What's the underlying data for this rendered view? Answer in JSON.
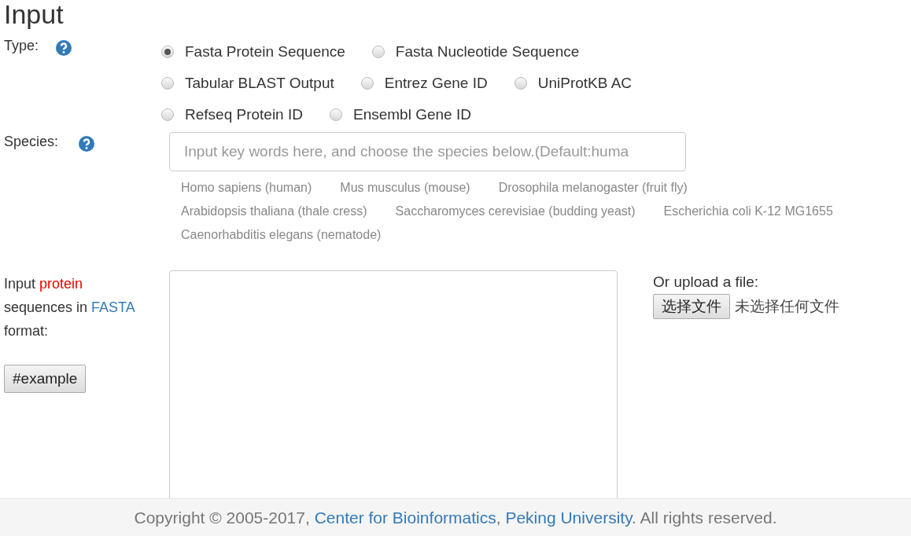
{
  "title": "Input",
  "type": {
    "label": "Type:",
    "rows": [
      [
        {
          "label": "Fasta Protein Sequence",
          "selected": true
        },
        {
          "label": "Fasta Nucleotide Sequence",
          "selected": false
        }
      ],
      [
        {
          "label": "Tabular BLAST Output",
          "selected": false
        },
        {
          "label": "Entrez Gene ID",
          "selected": false
        },
        {
          "label": "UniProtKB AC",
          "selected": false
        }
      ],
      [
        {
          "label": "Refseq Protein ID",
          "selected": false
        },
        {
          "label": "Ensembl Gene ID",
          "selected": false
        }
      ]
    ]
  },
  "species": {
    "label": "Species:",
    "placeholder": "Input key words here, and choose the species below.(Default:huma",
    "suggestions": [
      [
        "Homo sapiens (human)",
        "Mus musculus (mouse)",
        "Drosophila melanogaster (fruit fly)"
      ],
      [
        "Arabidopsis thaliana (thale cress)",
        "Saccharomyces cerevisiae (budding yeast)",
        "Escherichia coli K-12 MG1655"
      ],
      [
        "Caenorhabditis elegans (nematode)"
      ]
    ]
  },
  "sequence": {
    "label": [
      {
        "kind": "text",
        "text": "Input "
      },
      {
        "kind": "highlight",
        "text": "protein"
      },
      {
        "kind": "text",
        "text": " sequences in "
      },
      {
        "kind": "link",
        "text": "FASTA"
      },
      {
        "kind": "text",
        "text": " format:"
      }
    ],
    "example_button": "#example"
  },
  "upload": {
    "label": "Or upload a file:",
    "button": "选择文件",
    "status": "未选择任何文件"
  },
  "footer": [
    {
      "kind": "text",
      "text": "Copyright © 2005-2017, "
    },
    {
      "kind": "link",
      "text": "Center for Bioinformatics"
    },
    {
      "kind": "text",
      "text": ", "
    },
    {
      "kind": "link",
      "text": "Peking University"
    },
    {
      "kind": "text",
      "text": ". All rights reserved."
    }
  ]
}
